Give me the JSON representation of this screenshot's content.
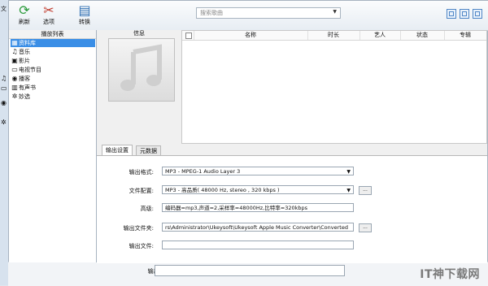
{
  "toolbar": {
    "refresh": "刷新",
    "options": "选项",
    "convert": "转换",
    "search_placeholder": "搜索歌曲"
  },
  "background_window": {
    "partial_title": "文",
    "output_file_label": "输出文件:",
    "watermark": "IT神下载网"
  },
  "playlist": {
    "header": "播放列表",
    "items": [
      {
        "icon": "library-icon",
        "label": "资料库"
      },
      {
        "icon": "music-note-icon",
        "label": "音乐"
      },
      {
        "icon": "film-icon",
        "label": "影片"
      },
      {
        "icon": "tv-icon",
        "label": "电视节目"
      },
      {
        "icon": "podcast-icon",
        "label": "播客"
      },
      {
        "icon": "book-icon",
        "label": "有声书"
      },
      {
        "icon": "gear-icon",
        "label": "妙选"
      }
    ]
  },
  "info": {
    "title": "信息"
  },
  "table": {
    "columns": [
      "名称",
      "时长",
      "艺人",
      "状态",
      "专辑"
    ]
  },
  "tabs": [
    "输出设置",
    "元数据"
  ],
  "settings": {
    "format_label": "输出格式:",
    "format_value": "MP3 - MPEG-1 Audio Layer 3",
    "profile_label": "文件配置:",
    "profile_value": "MP3 - 高品质( 48000 Hz, stereo , 320 kbps  )",
    "profile_button": "...",
    "advanced_label": "高级:",
    "advanced_value": "编码器=mp3,声道=2,采样率=48000Hz,比特率=320kbps",
    "folder_label": "输出文件夹:",
    "folder_value": "rs\\Administrator\\Ukeysoft\\Ukeysoft Apple Music Converter\\Converted",
    "folder_button": "...",
    "file_label": "输出文件:",
    "file_value": ""
  },
  "colors": {
    "selection": "#3a8ee6",
    "window_button": "#4f86c6"
  }
}
